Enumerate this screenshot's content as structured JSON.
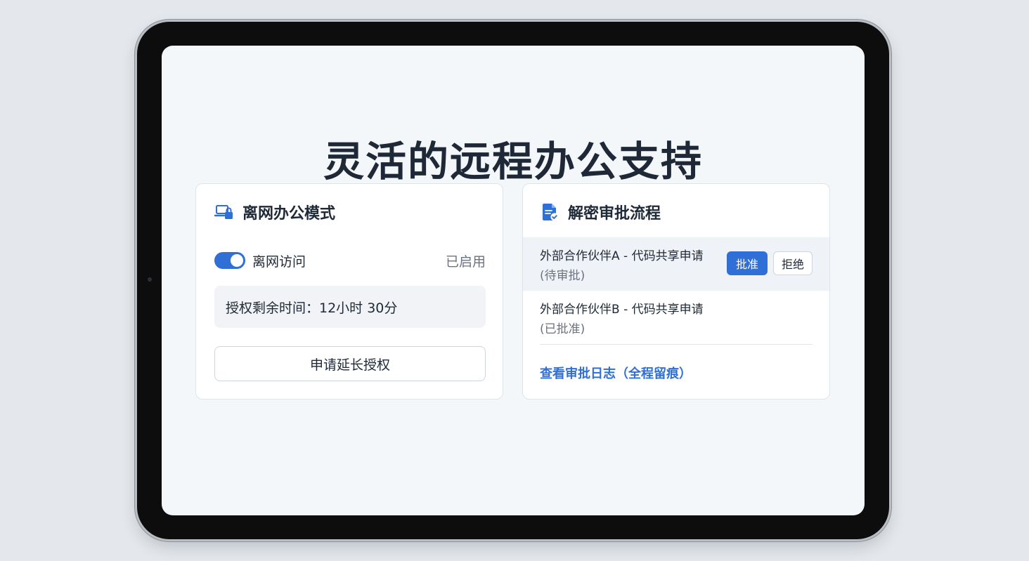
{
  "page": {
    "title": "灵活的远程办公支持"
  },
  "offline_card": {
    "icon": "laptop-lock-icon",
    "title": "离网办公模式",
    "toggle_label": "离网访问",
    "toggle_on": true,
    "status": "已启用",
    "time_remaining": "授权剩余时间：12小时 30分",
    "extend_button": "申请延长授权"
  },
  "approval_card": {
    "icon": "document-check-icon",
    "title": "解密审批流程",
    "requests": [
      {
        "name": "外部合作伙伴A - 代码共享申请",
        "status": "(待审批)",
        "approve_label": "批准",
        "reject_label": "拒绝"
      },
      {
        "name": "外部合作伙伴B - 代码共享申请",
        "status": "(已批准)"
      }
    ],
    "log_link": "查看审批日志（全程留痕）"
  },
  "colors": {
    "accent": "#2f6fd6",
    "title": "#1e2836",
    "text": "#1f2937",
    "muted": "#6b7280",
    "screen_bg": "#f4f7f9",
    "row_highlight": "#eff2f6"
  }
}
